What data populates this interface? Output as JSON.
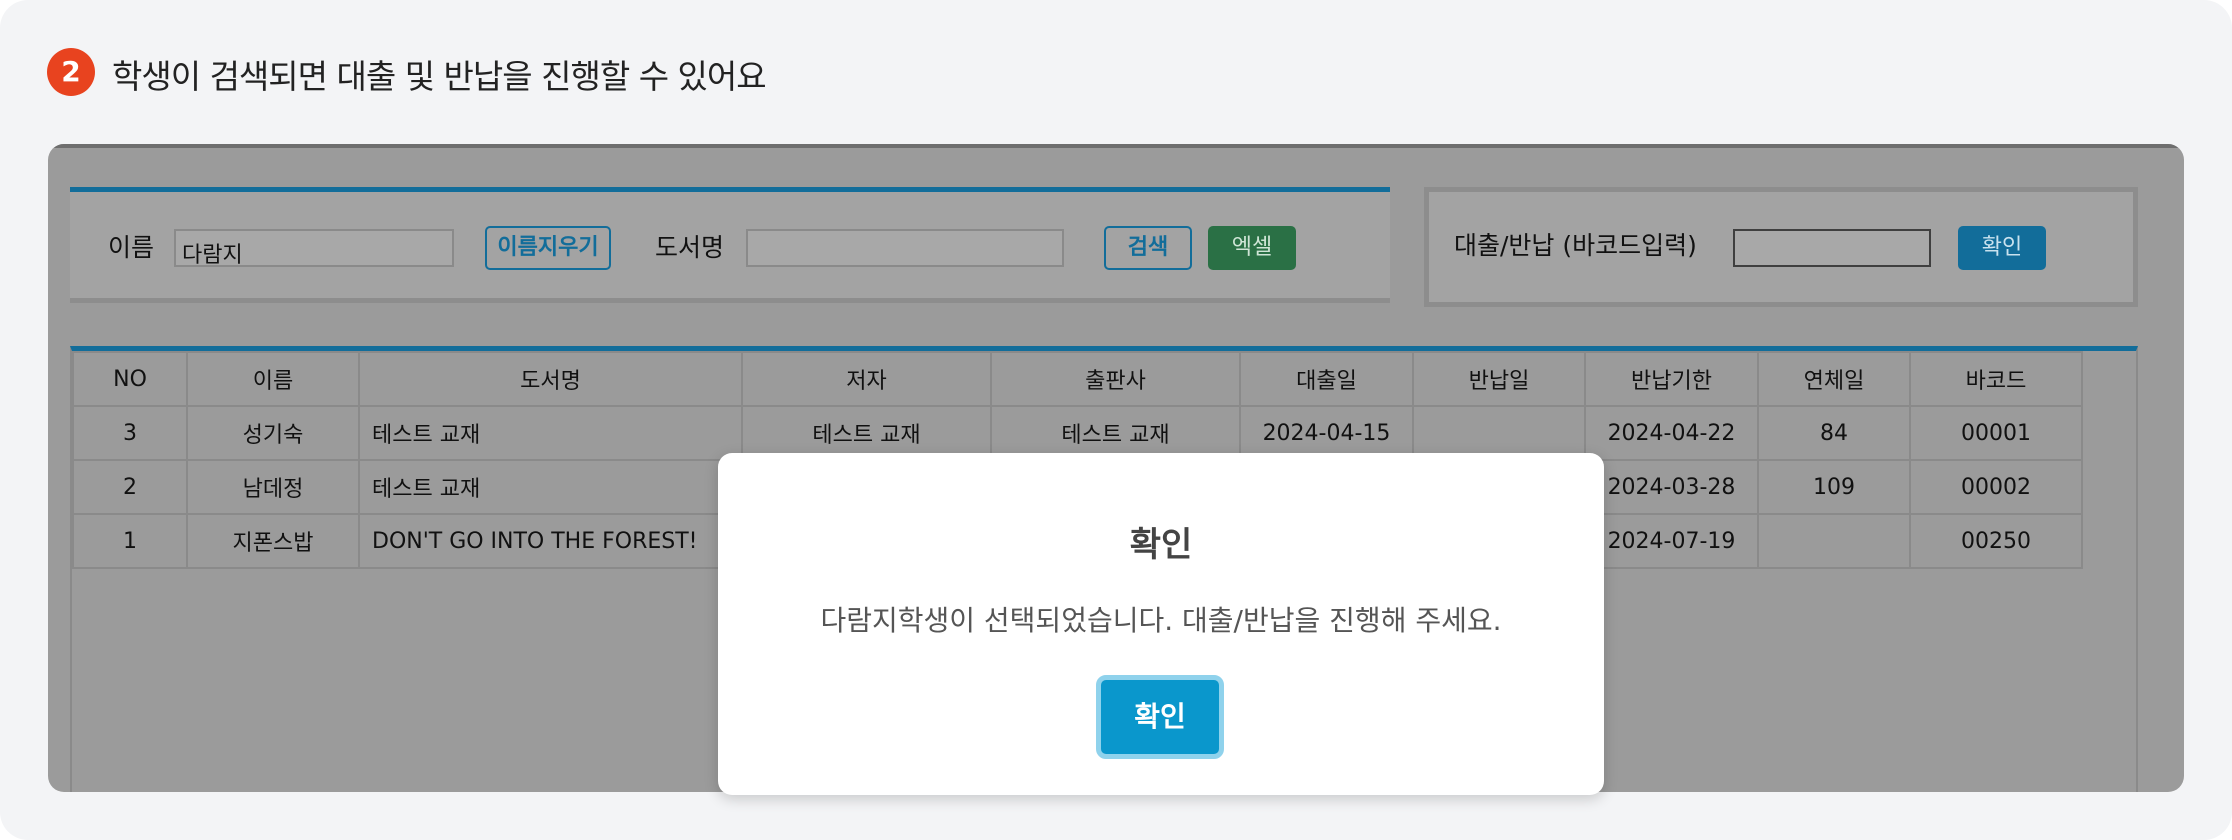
{
  "step": {
    "number": "2",
    "title": "학생이 검색되면 대출 및 반납을 진행할 수 있어요"
  },
  "search": {
    "name_label": "이름",
    "name_value": "다람지",
    "clear_name_label": "이름지우기",
    "book_label": "도서명",
    "book_value": "",
    "search_label": "검색",
    "excel_label": "엑셀"
  },
  "barcode": {
    "label": "대출/반납 (바코드입력)",
    "value": "",
    "confirm_label": "확인"
  },
  "table": {
    "headers": [
      "NO",
      "이름",
      "도서명",
      "저자",
      "출판사",
      "대출일",
      "반납일",
      "반납기한",
      "연체일",
      "바코드"
    ],
    "rows": [
      [
        "3",
        "성기숙",
        "테스트 교재",
        "테스트 교재",
        "테스트 교재",
        "2024-04-15",
        "",
        "2024-04-22",
        "84",
        "00001"
      ],
      [
        "2",
        "남데정",
        "테스트 교재",
        "",
        "",
        "",
        "",
        "2024-03-28",
        "109",
        "00002"
      ],
      [
        "1",
        "지폰스밥",
        "DON'T GO INTO THE FOREST!",
        "",
        "",
        "",
        "",
        "2024-07-19",
        "",
        "00250"
      ]
    ]
  },
  "modal": {
    "title": "확인",
    "message": "다람지학생이 선택되었습니다. 대출/반납을 진행해 주세요.",
    "button_label": "확인"
  },
  "colors": {
    "badge": "#e8431f",
    "accent_blue": "#126d9a",
    "excel_green": "#2a7045",
    "modal_button": "#0a97cc"
  }
}
